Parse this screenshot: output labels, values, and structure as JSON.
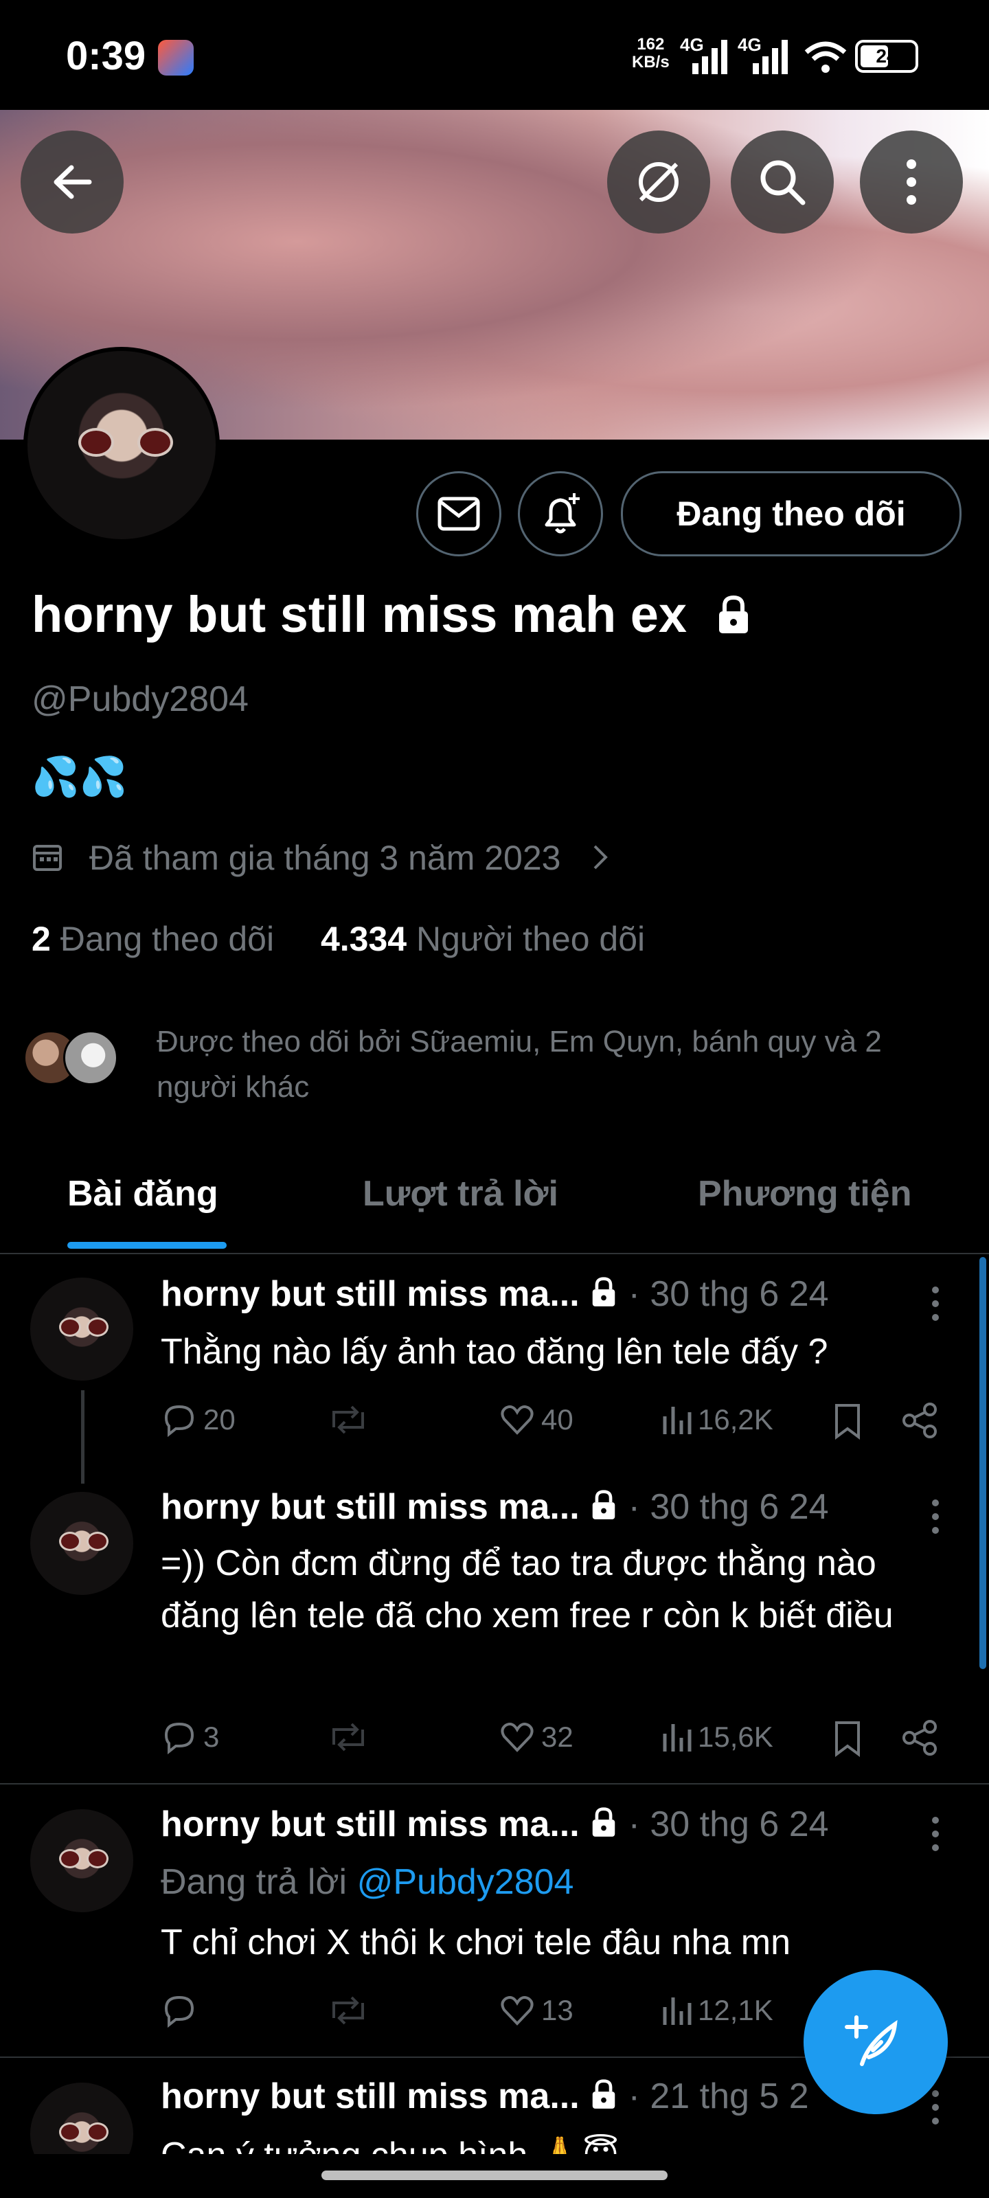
{
  "status_bar": {
    "time": "0:39",
    "speed_value": "162",
    "speed_unit": "KB/s",
    "net1": "4G",
    "net2": "4G",
    "battery": "24"
  },
  "profile": {
    "name": "horny but still miss mah ex",
    "handle": "@Pubdy2804",
    "bio": "💦💦",
    "joined": "Đã tham gia tháng 3 năm 2023",
    "following_count": "2",
    "following_label": "Đang theo dõi",
    "followers_count": "4.334",
    "followers_label": "Người theo dõi",
    "followed_by": "Được theo dõi bởi Sữaemiu, Em Quyn, bánh quy và 2 người khác",
    "follow_button": "Đang theo dõi"
  },
  "tabs": [
    "Bài đăng",
    "Lượt trả lời",
    "Phương tiện"
  ],
  "posts": [
    {
      "name": "horny but still miss ma...",
      "meta": "· 30 thg 6 24",
      "text": "Thằng nào lấy ảnh tao đăng lên tele đấy ?",
      "replies": "20",
      "likes": "40",
      "views": "16,2K"
    },
    {
      "name": "horny but still miss ma...",
      "meta": "· 30 thg 6 24",
      "text": "=)) Còn đcm đừng để tao tra được thằng nào đăng lên tele đã cho xem free r còn k biết điều",
      "replies": "3",
      "likes": "32",
      "views": "15,6K"
    },
    {
      "name": "horny but still miss ma...",
      "meta": "· 30 thg 6 24",
      "reply_prefix": "Đang trả lời",
      "reply_mention": "@Pubdy2804",
      "text": "T chỉ chơi X thôi k chơi tele đâu nha mn",
      "replies": "",
      "likes": "13",
      "views": "12,1K"
    },
    {
      "name": "horny but still miss ma...",
      "meta": "· 21 thg 5 2",
      "text": "Cạn ý tưởng chụp hình 🙏😇"
    }
  ],
  "icons": {
    "back": "arrow-left-icon",
    "grok": "grok-icon",
    "search": "search-icon",
    "more": "more-vertical-icon",
    "message": "envelope-icon",
    "notify": "bell-plus-icon",
    "lock": "lock-icon",
    "calendar": "calendar-icon",
    "compose": "compose-feather-icon"
  },
  "colors": {
    "accent": "#1d9bf0",
    "muted": "#71767b",
    "background": "#000000"
  }
}
